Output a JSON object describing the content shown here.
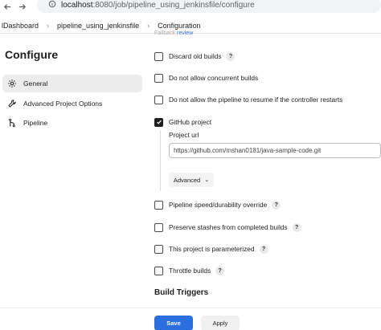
{
  "browser": {
    "url_host": "localhost",
    "url_path": ":8080/job/pipeline_using_jenkinsfile/configure"
  },
  "breadcrumb": {
    "items": [
      "lDashboard",
      "pipeline_using_jenkinsfile",
      "Configuration"
    ]
  },
  "page": {
    "title": "Configure",
    "faded_text": "Fallback",
    "faded_link": "review"
  },
  "sidebar": {
    "items": [
      {
        "label": "General",
        "icon": "gear-icon",
        "active": true
      },
      {
        "label": "Advanced Project Options",
        "icon": "wrench-icon",
        "active": false
      },
      {
        "label": "Pipeline",
        "icon": "pipeline-icon",
        "active": false
      }
    ]
  },
  "options": [
    {
      "label": "Discard old builds",
      "checked": false,
      "help": "?"
    },
    {
      "label": "Do not allow concurrent builds",
      "checked": false,
      "help": ""
    },
    {
      "label": "Do not allow the pipeline to resume if the controller restarts",
      "checked": false,
      "help": ""
    },
    {
      "label": "GitHub project",
      "checked": true,
      "help": ""
    },
    {
      "label": "Pipeline speed/durability override",
      "checked": false,
      "help": "?"
    },
    {
      "label": "Preserve stashes from completed builds",
      "checked": false,
      "help": "?"
    },
    {
      "label": "This project is parameterized",
      "checked": false,
      "help": "?"
    },
    {
      "label": "Throttle builds",
      "checked": false,
      "help": "?"
    }
  ],
  "github": {
    "field_label": "Project url",
    "project_url": "https://github.com/mshan0181/java-sample-code.git",
    "advanced_label": "Advanced",
    "chevron": "⌄"
  },
  "section": {
    "build_triggers": "Build Triggers"
  },
  "actions": {
    "save_label": "Save",
    "apply_label": "Apply"
  },
  "colors": {
    "primary": "#2a6fdb",
    "sidebar_active": "#ececec"
  }
}
